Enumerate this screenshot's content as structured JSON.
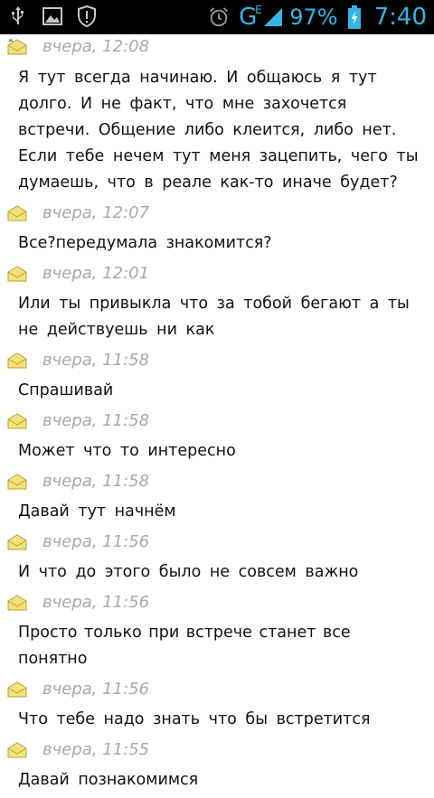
{
  "status_bar": {
    "network_type": "G",
    "network_sub": "E",
    "battery_percent": "97%",
    "time": "7:40",
    "accent_color": "#33b5e5"
  },
  "messages": [
    {
      "time": "вчера, 12:08",
      "text": "Я тут всегда начинаю. И общаюсь я тут долго. И не факт, что мне захочется встречи. Общение либо клеится, либо нет. Если тебе нечем тут меня зацепить, чего ты думаешь, что в реале как-то иначе будет?"
    },
    {
      "time": "вчера, 12:07",
      "text": "Все?передумала  знакомится?"
    },
    {
      "time": "вчера, 12:01",
      "text": "Или ты привыкла что за тобой бегают а ты не действуешь ни как"
    },
    {
      "time": "вчера, 11:58",
      "text": "Спрашивай"
    },
    {
      "time": "вчера, 11:58",
      "text": "Может что то интересно"
    },
    {
      "time": "вчера, 11:58",
      "text": "Давай тут начнём"
    },
    {
      "time": "вчера, 11:56",
      "text": "И что до этого было не совсем важно"
    },
    {
      "time": "вчера, 11:56",
      "text": "Просто только при встрече станет все понятно"
    },
    {
      "time": "вчера, 11:56",
      "text": "Что тебе надо знать что бы встретится"
    },
    {
      "time": "вчера, 11:55",
      "text": "Давай познакомимся"
    }
  ]
}
